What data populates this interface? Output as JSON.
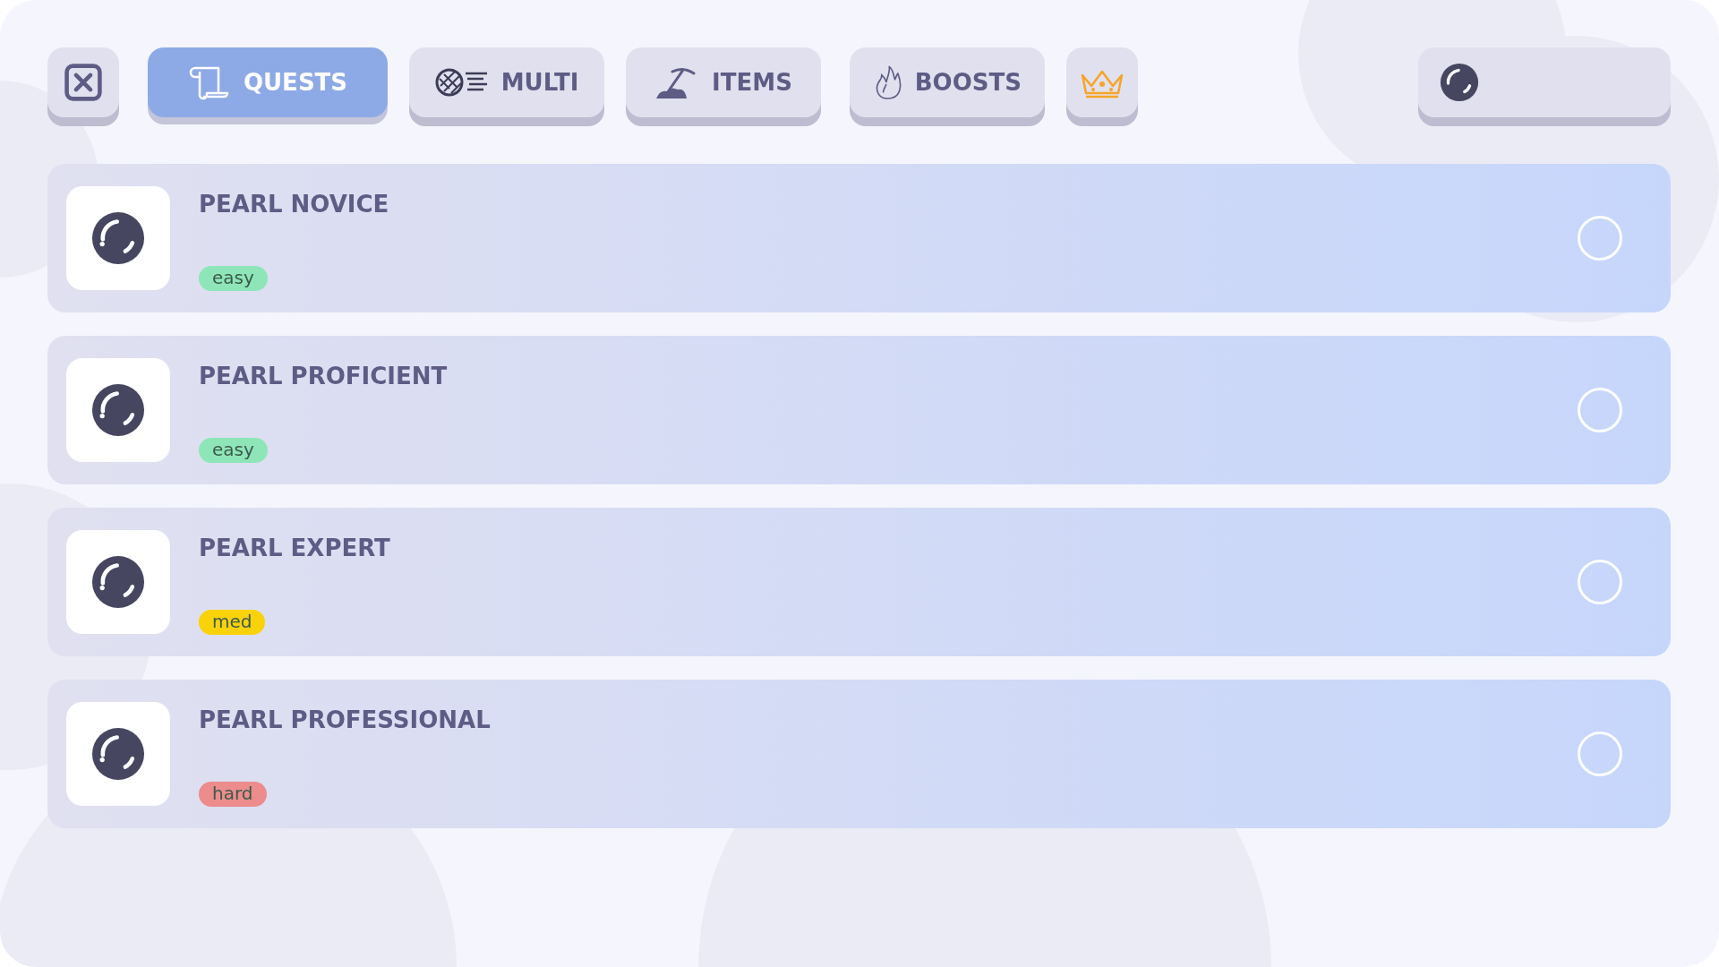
{
  "tabs": [
    {
      "kind": "quests",
      "label": "QUESTS",
      "selected": true
    },
    {
      "kind": "multi",
      "label": "MULTI",
      "selected": false
    },
    {
      "kind": "items",
      "label": "ITEMS",
      "selected": false
    },
    {
      "kind": "boosts",
      "label": "BOOSTS",
      "selected": false
    },
    {
      "kind": "crown",
      "selected": false
    }
  ],
  "quests": [
    {
      "title": "PEARL NOVICE",
      "difficulty": "easy",
      "color": "#8ee6b8",
      "completed": false
    },
    {
      "title": "PEARL PROFICIENT",
      "difficulty": "easy",
      "color": "#8ee6b8",
      "completed": false
    },
    {
      "title": "PEARL EXPERT",
      "difficulty": "med",
      "color": "#f9d20a",
      "completed": false
    },
    {
      "title": "PEARL PROFESSIONAL",
      "difficulty": "hard",
      "color": "#ec8c8c",
      "completed": false
    }
  ]
}
